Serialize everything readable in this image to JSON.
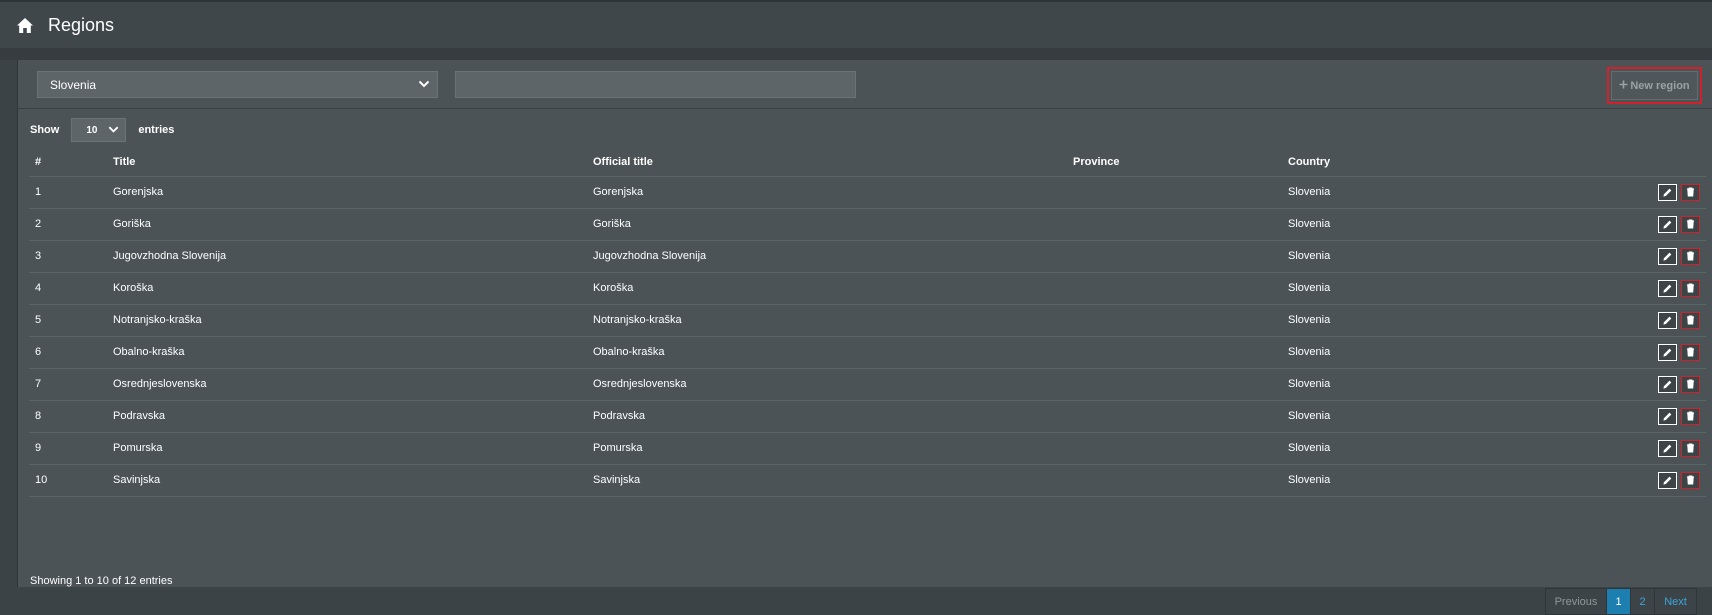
{
  "header": {
    "title": "Regions",
    "icon": "home-icon"
  },
  "toolbar": {
    "country_value": "Slovenia",
    "search_value": "",
    "new_button_label": "New region"
  },
  "length": {
    "show_label": "Show",
    "value": "10",
    "entries_label": "entries"
  },
  "table": {
    "columns": [
      "#",
      "Title",
      "Official title",
      "Province",
      "Country"
    ],
    "rows": [
      {
        "num": "1",
        "title": "Gorenjska",
        "official": "Gorenjska",
        "province": "",
        "country": "Slovenia"
      },
      {
        "num": "2",
        "title": "Goriška",
        "official": "Goriška",
        "province": "",
        "country": "Slovenia"
      },
      {
        "num": "3",
        "title": "Jugovzhodna Slovenija",
        "official": "Jugovzhodna Slovenija",
        "province": "",
        "country": "Slovenia"
      },
      {
        "num": "4",
        "title": "Koroška",
        "official": "Koroška",
        "province": "",
        "country": "Slovenia"
      },
      {
        "num": "5",
        "title": "Notranjsko-kraška",
        "official": "Notranjsko-kraška",
        "province": "",
        "country": "Slovenia"
      },
      {
        "num": "6",
        "title": "Obalno-kraška",
        "official": "Obalno-kraška",
        "province": "",
        "country": "Slovenia"
      },
      {
        "num": "7",
        "title": "Osrednjeslovenska",
        "official": "Osrednjeslovenska",
        "province": "",
        "country": "Slovenia"
      },
      {
        "num": "8",
        "title": "Podravska",
        "official": "Podravska",
        "province": "",
        "country": "Slovenia"
      },
      {
        "num": "9",
        "title": "Pomurska",
        "official": "Pomurska",
        "province": "",
        "country": "Slovenia"
      },
      {
        "num": "10",
        "title": "Savinjska",
        "official": "Savinjska",
        "province": "",
        "country": "Slovenia"
      }
    ]
  },
  "info": "Showing 1 to 10 of 12 entries",
  "pagination": {
    "previous": "Previous",
    "pages": [
      "1",
      "2"
    ],
    "current": "1",
    "next": "Next"
  },
  "colors": {
    "accent": "#1c7fb0",
    "link": "#3aa6de",
    "danger": "#d1212a",
    "panel": "#4b5357"
  }
}
